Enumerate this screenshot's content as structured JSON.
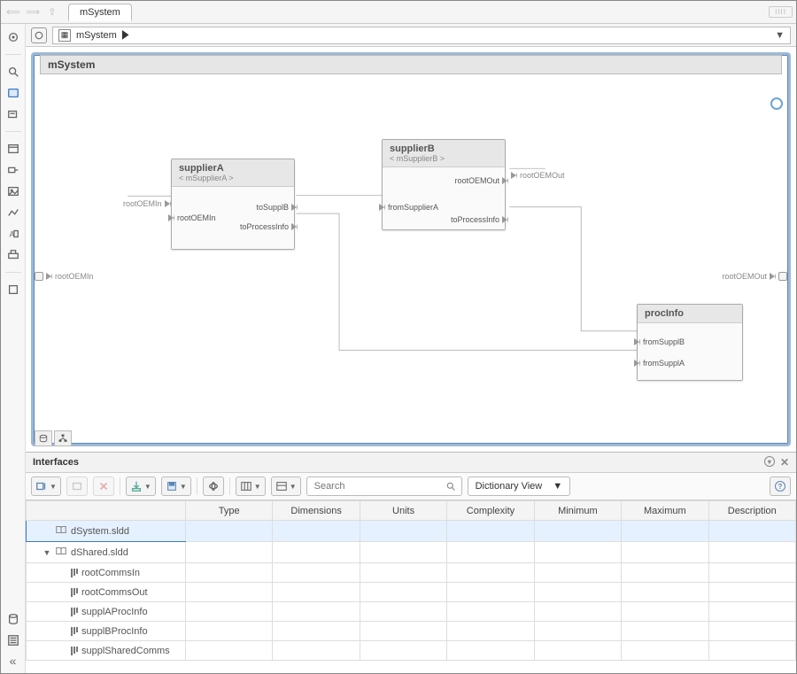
{
  "topbar": {
    "tab_label": "mSystem",
    "keyboard_badge": "▥"
  },
  "breadcrumb": {
    "label": "mSystem"
  },
  "left_tools": [
    {
      "name": "target-icon"
    },
    {
      "name": "zoom-icon"
    },
    {
      "name": "fit-icon"
    },
    {
      "name": "annotation-icon"
    },
    {
      "name": "window-icon"
    },
    {
      "name": "port-icon"
    },
    {
      "name": "image-icon"
    },
    {
      "name": "chart-icon"
    },
    {
      "name": "text-icon"
    },
    {
      "name": "step-icon"
    },
    {
      "name": "shape-icon"
    }
  ],
  "canvas": {
    "title": "mSystem",
    "ext_ports": {
      "left_label": "rootOEMIn",
      "right_label": "rootOEMOut"
    },
    "blocks": {
      "supplierA": {
        "title": "supplierA",
        "subtitle": "< mSupplierA >",
        "ports_left": [
          {
            "label": "rootOEMIn"
          }
        ],
        "ports_right": [
          {
            "label": "toSupplB"
          },
          {
            "label": "toProcessInfo"
          }
        ],
        "external_left_label": "rootOEMIn"
      },
      "supplierB": {
        "title": "supplierB",
        "subtitle": "< mSupplierB >",
        "ports_left": [
          {
            "label": "fromSupplierA"
          }
        ],
        "ports_right": [
          {
            "label": "rootOEMOut"
          },
          {
            "label": "toProcessInfo"
          }
        ],
        "external_right_label": "rootOEMOut"
      },
      "procInfo": {
        "title": "procInfo",
        "ports_left": [
          {
            "label": "fromSupplB"
          },
          {
            "label": "fromSupplA"
          }
        ]
      }
    }
  },
  "interfaces": {
    "panel_title": "Interfaces",
    "toolbar": {
      "search_placeholder": "Search",
      "view_select": "Dictionary View"
    },
    "columns": [
      "",
      "Type",
      "Dimensions",
      "Units",
      "Complexity",
      "Minimum",
      "Maximum",
      "Description"
    ],
    "rows": [
      {
        "indent": 0,
        "caret": "",
        "icon": "dict",
        "label": "dSystem.sldd",
        "selected": true
      },
      {
        "indent": 0,
        "caret": "▼",
        "icon": "dict",
        "label": "dShared.sldd",
        "selected": false
      },
      {
        "indent": 1,
        "caret": "",
        "icon": "stack",
        "label": "rootCommsIn",
        "selected": false
      },
      {
        "indent": 1,
        "caret": "",
        "icon": "stack",
        "label": "rootCommsOut",
        "selected": false
      },
      {
        "indent": 1,
        "caret": "",
        "icon": "stack",
        "label": "supplAProcInfo",
        "selected": false
      },
      {
        "indent": 1,
        "caret": "",
        "icon": "stack",
        "label": "supplBProcInfo",
        "selected": false
      },
      {
        "indent": 1,
        "caret": "",
        "icon": "stack",
        "label": "supplSharedComms",
        "selected": false
      }
    ]
  }
}
